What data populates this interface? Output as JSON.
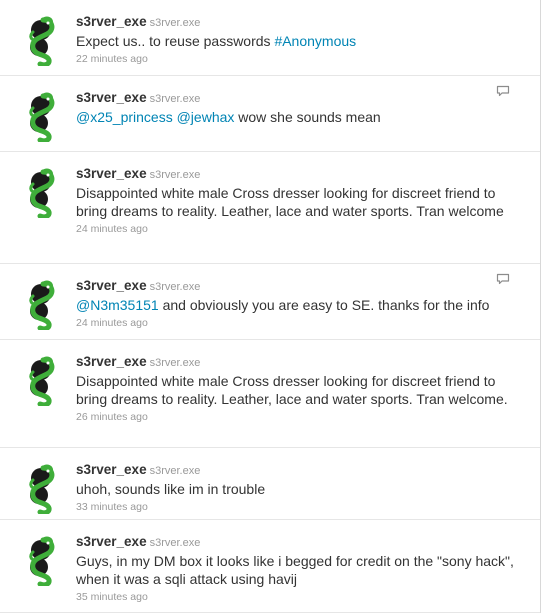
{
  "tweets": [
    {
      "name": "s3rver_exe",
      "handle": "s3rver.exe",
      "segments": [
        {
          "text": "Expect us.. to reuse passwords ",
          "link": false
        },
        {
          "text": "#Anonymous",
          "link": true
        }
      ],
      "time": "22 minutes ago",
      "reply_icon": false
    },
    {
      "name": "s3rver_exe",
      "handle": "s3rver.exe",
      "segments": [
        {
          "text": "@x25_princess",
          "link": true
        },
        {
          "text": " ",
          "link": false
        },
        {
          "text": "@jewhax",
          "link": true
        },
        {
          "text": " wow she sounds mean",
          "link": false
        }
      ],
      "time": "",
      "reply_icon": true
    },
    {
      "name": "s3rver_exe",
      "handle": "s3rver.exe",
      "segments": [
        {
          "text": "Disappointed white male Cross dresser looking for discreet friend to bring dreams to reality. Leather, lace and water sports. Tran welcome",
          "link": false
        }
      ],
      "time": "24 minutes ago",
      "reply_icon": false
    },
    {
      "name": "s3rver_exe",
      "handle": "s3rver.exe",
      "segments": [
        {
          "text": "@N3m35151",
          "link": true
        },
        {
          "text": " and obviously you are easy to SE. thanks for the info",
          "link": false
        }
      ],
      "time": "24 minutes ago",
      "reply_icon": true
    },
    {
      "name": "s3rver_exe",
      "handle": "s3rver.exe",
      "segments": [
        {
          "text": "Disappointed white male Cross dresser looking for discreet friend to bring dreams to reality. Leather, lace and water sports. Tran welcome.",
          "link": false
        }
      ],
      "time": "26 minutes ago",
      "reply_icon": false
    },
    {
      "name": "s3rver_exe",
      "handle": "s3rver.exe",
      "segments": [
        {
          "text": "uhoh, sounds like im in trouble",
          "link": false
        }
      ],
      "time": "33 minutes ago",
      "reply_icon": false
    },
    {
      "name": "s3rver_exe",
      "handle": "s3rver.exe",
      "segments": [
        {
          "text": "Guys, in my DM box it looks like i begged for credit on the \"sony hack\", when it was a sqli attack using havij",
          "link": false
        }
      ],
      "time": "35 minutes ago",
      "reply_icon": false
    }
  ],
  "colors": {
    "link": "#0084b4",
    "text": "#333333",
    "meta": "#999999",
    "divider": "#e6e6e6",
    "avatar_green": "#3fae3a",
    "avatar_dark": "#1a1a1a"
  },
  "icons": {
    "avatar": "green-snake-avatar-icon",
    "reply": "reply-speech-bubble-icon"
  }
}
